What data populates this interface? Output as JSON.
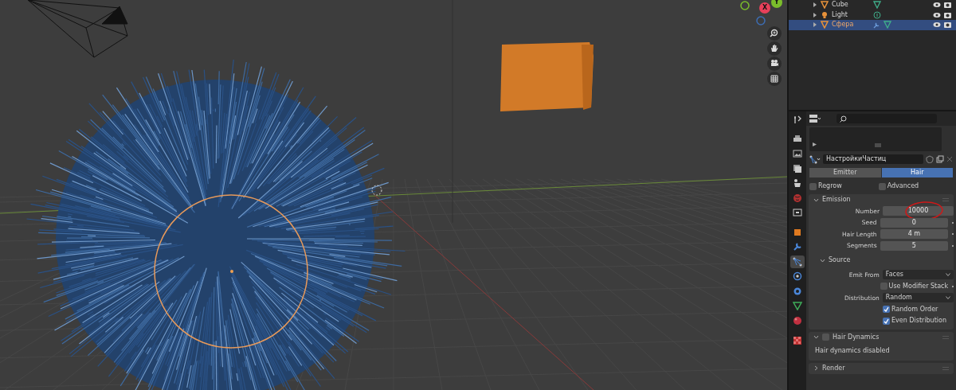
{
  "viewport": {
    "gizmo_axes": [
      {
        "label": "X",
        "color": "#e8405a"
      },
      {
        "label": "Y",
        "color": "#7bbd2b"
      }
    ],
    "nav_buttons": [
      {
        "kind": "zoom"
      },
      {
        "kind": "hand"
      },
      {
        "kind": "camera"
      },
      {
        "kind": "grid"
      }
    ]
  },
  "outliner": {
    "items": [
      {
        "name": "Cube",
        "kind": "mesh",
        "selected": false,
        "modifier": false
      },
      {
        "name": "Light",
        "kind": "light",
        "selected": false,
        "modifier": false
      },
      {
        "name": "Сфера",
        "kind": "mesh",
        "selected": true,
        "modifier": true
      }
    ]
  },
  "properties": {
    "tabs": [
      {
        "kind": "tool",
        "selected": false
      },
      {
        "kind": "render",
        "selected": false
      },
      {
        "kind": "output",
        "selected": false
      },
      {
        "kind": "view",
        "selected": false
      },
      {
        "kind": "scene",
        "selected": false
      },
      {
        "kind": "world",
        "selected": false
      },
      {
        "kind": "collection",
        "selected": false
      },
      {
        "kind": "object",
        "selected": false
      },
      {
        "kind": "modifier",
        "selected": false
      },
      {
        "kind": "particles",
        "selected": true
      },
      {
        "kind": "physics",
        "selected": false
      },
      {
        "kind": "constraints",
        "selected": false
      },
      {
        "kind": "data",
        "selected": false
      },
      {
        "kind": "material",
        "selected": false
      },
      {
        "kind": "texture",
        "selected": false
      }
    ],
    "settings_name": "НастройкиЧастиц",
    "type_toggle": [
      {
        "label": "Emitter",
        "selected": false
      },
      {
        "label": "Hair",
        "selected": true
      }
    ],
    "options": [
      {
        "label": "Regrow",
        "checked": false
      },
      {
        "label": "Advanced",
        "checked": false
      }
    ],
    "emission": {
      "title": "Emission",
      "expanded": true,
      "fields": [
        {
          "label": "Number",
          "value": "10000",
          "annotated": true
        },
        {
          "label": "Seed",
          "value": "0",
          "annotated": false
        },
        {
          "label": "Hair Length",
          "value": "4 m",
          "annotated": false
        },
        {
          "label": "Segments",
          "value": "5",
          "annotated": false
        }
      ],
      "source": {
        "title": "Source",
        "expanded": true,
        "rows": [
          {
            "kind": "dropdown",
            "label": "Emit From",
            "value": "Faces"
          },
          {
            "kind": "checkbox",
            "label": "Use Modifier Stack",
            "checked": false
          },
          {
            "kind": "dropdown",
            "label": "Distribution",
            "value": "Random"
          },
          {
            "kind": "checkbox",
            "label": "Random Order",
            "checked": true
          },
          {
            "kind": "checkbox",
            "label": "Even Distribution",
            "checked": true
          }
        ]
      }
    },
    "hair_dynamics": {
      "title": "Hair Dynamics",
      "expanded": true,
      "enabled": false,
      "message": "Hair dynamics disabled"
    },
    "render": {
      "title": "Render",
      "expanded": false
    }
  }
}
